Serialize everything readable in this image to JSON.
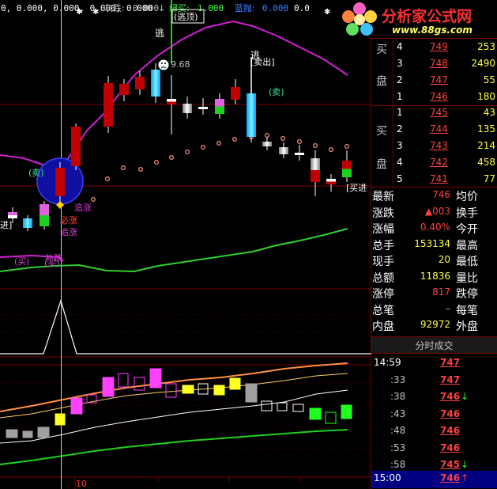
{
  "indicator_bar": {
    "v1": "0, 0.000, 0.000, 0.000, 0.000",
    "gray_label": "灰跌:",
    "gray_val": "0.000",
    "green_label": "绿买:",
    "green_val": "1.000",
    "blue_label": "蓝抛:",
    "blue_val": "0.000",
    "tail": "0.0",
    "arrow": "↓"
  },
  "brand": {
    "name": "分析家公式网",
    "url": "www.88gs.com"
  },
  "chart_labels": {
    "escape_top": "逃",
    "escape_top_box": "(逃顶)",
    "price_tag": "9.68",
    "escape2": "逃",
    "sell_out": "[卖出]",
    "sell_a": "(卖)",
    "sell_b": "(卖)",
    "buy_a": "(买)",
    "buy_b": "(买)",
    "bi_zhang": "必涨",
    "zhui_zhang_a": "追涨",
    "zhui_zhang_b": "追涨",
    "bu_die": "补跌",
    "ting_ban": "进]",
    "buy_in": "[买进",
    "date_marker": "10"
  },
  "order_book": {
    "sell_label": [
      "买",
      "盘"
    ],
    "buy_label": [
      "买",
      "盘"
    ],
    "sell": [
      {
        "level": "4",
        "price": "749",
        "vol": "253"
      },
      {
        "level": "3",
        "price": "748",
        "vol": "2490"
      },
      {
        "level": "2",
        "price": "747",
        "vol": "55"
      },
      {
        "level": "1",
        "price": "746",
        "vol": "180"
      }
    ],
    "buy": [
      {
        "level": "1",
        "price": "745",
        "vol": "43"
      },
      {
        "level": "2",
        "price": "744",
        "vol": "135"
      },
      {
        "level": "3",
        "price": "743",
        "vol": "214"
      },
      {
        "level": "4",
        "price": "742",
        "vol": "458"
      },
      {
        "level": "5",
        "price": "741",
        "vol": "77"
      }
    ]
  },
  "stats": [
    {
      "label": "最新",
      "value": "746",
      "label2": "均价",
      "color": "#ff4040"
    },
    {
      "label": "涨跌",
      "value": "▲003",
      "label2": "换手",
      "color": "#ff4040"
    },
    {
      "label": "涨幅",
      "value": "0.40%",
      "label2": "今开",
      "color": "#ff4040"
    },
    {
      "label": "总手",
      "value": "153134",
      "label2": "最高",
      "color": "#ffff40"
    },
    {
      "label": "现手",
      "value": "20",
      "label2": "最低",
      "color": "#ffff40"
    },
    {
      "label": "总额",
      "value": "11836",
      "label2": "量比",
      "color": "#ffff40"
    },
    {
      "label": "涨停",
      "value": "817",
      "label2": "跌停",
      "color": "#ff4040"
    },
    {
      "label": "总笔",
      "value": "–",
      "label2": "每笔",
      "color": "#c0c0c0"
    },
    {
      "label": "内盘",
      "value": "92972",
      "label2": "外盘",
      "color": "#ffff40"
    }
  ],
  "ticks_header": "分时成交",
  "ticks": [
    {
      "time": "14:59",
      "price": "747",
      "arrow": ""
    },
    {
      "time": ":33",
      "price": "747",
      "arrow": ""
    },
    {
      "time": ":38",
      "price": "746",
      "arrow": "↓"
    },
    {
      "time": ":43",
      "price": "746",
      "arrow": ""
    },
    {
      "time": ":48",
      "price": "746",
      "arrow": ""
    },
    {
      "time": ":53",
      "price": "746",
      "arrow": ""
    },
    {
      "time": ":58",
      "price": "745",
      "arrow": "↓"
    },
    {
      "time": "15:00",
      "price": "746",
      "arrow": "↑"
    }
  ]
}
